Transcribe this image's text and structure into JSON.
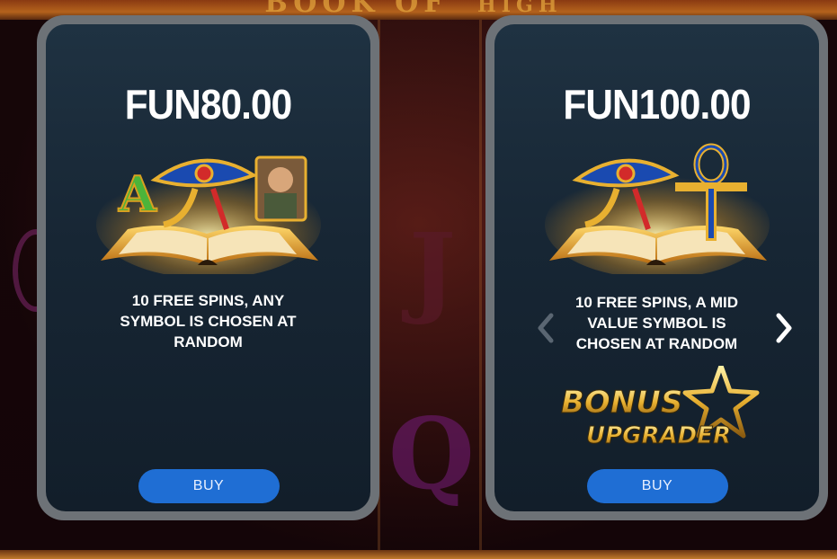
{
  "background": {
    "title_fragment": "BOOK OF",
    "title_fragment2": "HIGH",
    "reel_letters": [
      "J",
      "Q"
    ]
  },
  "offers": [
    {
      "price": "FUN80.00",
      "description": "10 FREE SPINS, ANY SYMBOL IS CHOSEN AT RANDOM",
      "buy_label": "BUY",
      "artwork": "book-with-symbols-icon"
    },
    {
      "price": "FUN100.00",
      "description": "10 FREE SPINS, A MID VALUE SYMBOL IS CHOSEN AT RANDOM",
      "buy_label": "BUY",
      "artwork": "book-with-ankh-icon",
      "badge": {
        "line1": "BONUS",
        "line2": "UPGRADER"
      }
    }
  ],
  "colors": {
    "buy_button": "#1f6ed4",
    "card_frame": "#6d7277",
    "card_panel": "#172634",
    "gold": "#e8b030"
  }
}
